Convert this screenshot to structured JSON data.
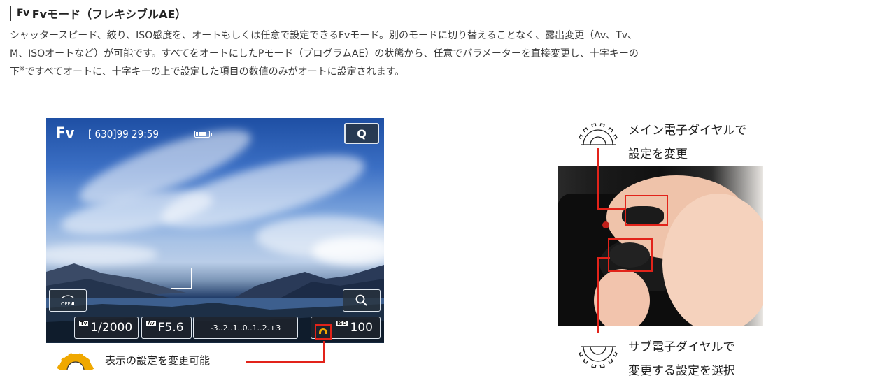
{
  "heading": {
    "badge": "Fv",
    "title": "Fvモード（フレキシブルAE）"
  },
  "description": {
    "line1": "シャッタースピード、絞り、ISO感度を、オートもしくは任意で設定できるFvモード。別のモードに切り替えることなく、露出変更（Av、Tv、",
    "line2": "M、ISOオートなど）が可能です。すべてをオートにしたPモード（プログラムAE）の状態から、任意でパラメーターを直接変更し、十字キーの",
    "line3_pre": "下",
    "line3_note": "※",
    "line3_post": "ですべてオートに、十字キーの上で設定した項目の数値のみがオートに設定されます。"
  },
  "screen": {
    "mode": "Fv",
    "shots": "[ 630]99 29:59",
    "q_label": "Q",
    "touch_label": "OFF",
    "tv_tag": "Tv",
    "tv_value": "1/2000",
    "av_tag": "Av",
    "av_value": "F5.6",
    "exposure_scale": "-3..2..1..0..1..2.+3",
    "iso_tag": "ISO",
    "iso_value": "100"
  },
  "captions": {
    "left": "表示の設定を変更可能",
    "main_dial_line1": "メイン電子ダイヤルで",
    "main_dial_line2": "設定を変更",
    "sub_dial_line1": "サブ電子ダイヤルで",
    "sub_dial_line2": "変更する設定を選択"
  },
  "colors": {
    "accent_red": "#e2231a",
    "dial_orange": "#f0a800"
  }
}
